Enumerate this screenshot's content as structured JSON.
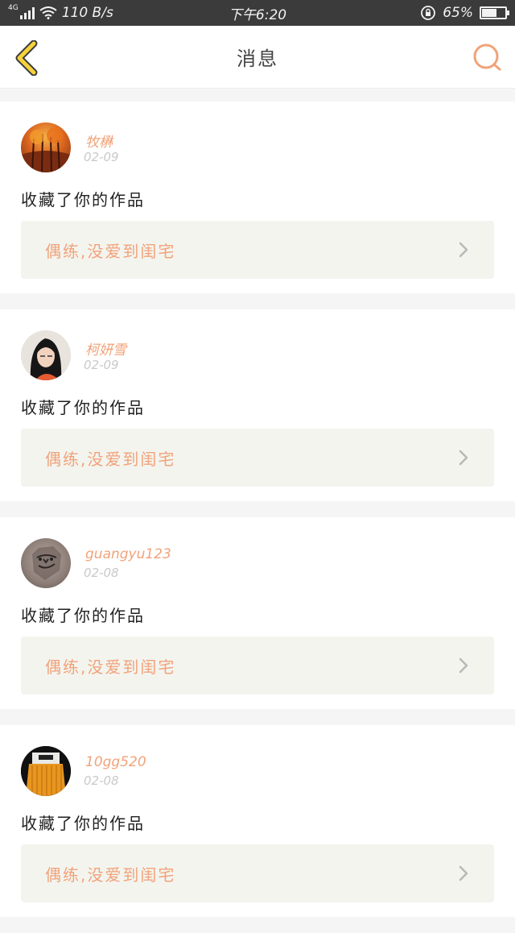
{
  "status_bar": {
    "network": "4G",
    "speed": "110 B/s",
    "time": "下午6:20",
    "battery": "65%",
    "battery_level": 0.65
  },
  "nav": {
    "title": "消息",
    "back_icon": "chevron-left-icon",
    "search_icon": "search-icon"
  },
  "messages": [
    {
      "username": "牧楙",
      "date": "02-09",
      "action": "收藏了你的作品",
      "work_title": "偶练,没爱到闺宅"
    },
    {
      "username": "柯妍雪",
      "date": "02-09",
      "action": "收藏了你的作品",
      "work_title": "偶练,没爱到闺宅"
    },
    {
      "username": "guangyu123",
      "date": "02-08",
      "action": "收藏了你的作品",
      "work_title": "偶练,没爱到闺宅"
    },
    {
      "username": "10gg520",
      "date": "02-08",
      "action": "收藏了你的作品",
      "work_title": "偶练,没爱到闺宅"
    }
  ],
  "colors": {
    "accent_orange": "#f0a37a",
    "back_yellow": "#f5d23a",
    "card_bg": "#ffffff",
    "work_bg": "#f4f4ef"
  }
}
